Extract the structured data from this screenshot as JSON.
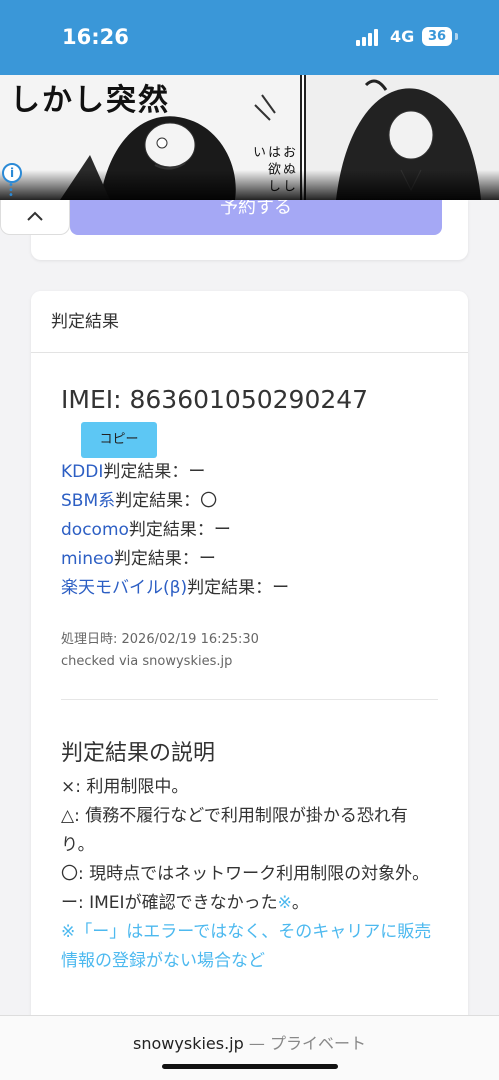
{
  "status_bar": {
    "time": "16:26",
    "network": "4G",
    "battery": "36",
    "bg_color": "#3a97d8"
  },
  "ad": {
    "headline": "しかし突然",
    "side_text": "お ぬ し は 欲 し い",
    "info_icon": "info-icon"
  },
  "prev_card": {
    "button_label": "予約する"
  },
  "result": {
    "header": "判定結果",
    "imei_label": "IMEI: ",
    "imei": "863601050290247",
    "copy_label": "コピー",
    "rows": [
      {
        "carrier": "KDDI",
        "suffix": "判定結果：",
        "value": "ー"
      },
      {
        "carrier": "SBM系",
        "suffix": "判定結果：",
        "value": "〇"
      },
      {
        "carrier": "docomo",
        "suffix": "判定結果：",
        "value": "ー"
      },
      {
        "carrier": "mineo",
        "suffix": "判定結果：",
        "value": "ー"
      },
      {
        "carrier": "楽天モバイル(β)",
        "suffix": "判定結果：",
        "value": "ー"
      }
    ],
    "processed_at": "処理日時: 2026/02/19 16:25:30",
    "checked_via": "checked via snowyskies.jp"
  },
  "explanation": {
    "title": "判定結果の説明",
    "lines": [
      "×: 利用制限中。",
      "△: 債務不履行などで利用制限が掛かる恐れ有り。",
      "〇: 現時点ではネットワーク利用制限の対象外。"
    ],
    "dash_line": "ー: IMEIが確認できなかった",
    "dash_mark": "※",
    "dash_end": "。",
    "note": "※「ー」はエラーではなく、そのキャリアに販売情報の登録がない場合など"
  },
  "bottom_bar": {
    "domain": "snowyskies.jp",
    "separator": " — ",
    "mode": "プライベート"
  }
}
